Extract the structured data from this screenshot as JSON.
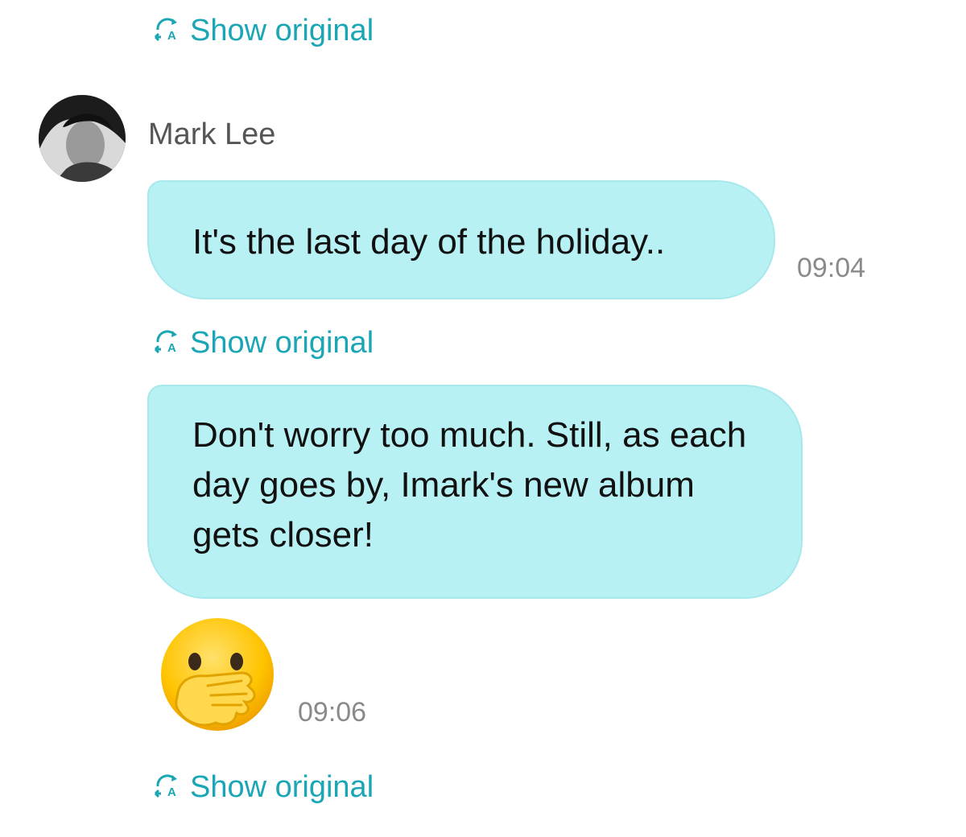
{
  "translate_link_label": "Show original",
  "translate_icon": "translate-icon",
  "sender": {
    "name": "Mark Lee",
    "avatar": "avatar-photo"
  },
  "messages": [
    {
      "text": "It's the last day of the holiday..",
      "time": "09:04"
    },
    {
      "text": "Don't worry too much. Still, as each day goes by, Imark's new album gets closer!",
      "time": ""
    },
    {
      "emoji": "face-with-hand-over-mouth",
      "time": "09:06"
    }
  ],
  "colors": {
    "accent": "#1aa6b5",
    "bubble": "#b8f1f4",
    "bubble_border": "#a6e8ec",
    "timestamp": "#8a8a8a"
  }
}
